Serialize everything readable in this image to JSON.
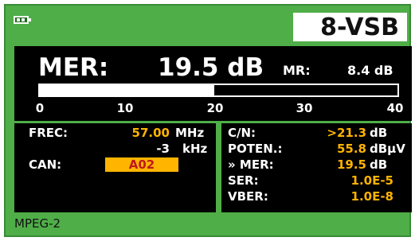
{
  "header": {
    "battery_icon": "battery-icon",
    "mode": "8-VSB"
  },
  "mer": {
    "label": "MER:",
    "value": "19.5 dB",
    "mr_label": "MR:",
    "mr_value": "8.4 dB",
    "bar_level": 19.5,
    "bar_max": 40,
    "scale": [
      "0",
      "10",
      "20",
      "30",
      "40"
    ]
  },
  "tuning": {
    "freq_label": "FREC:",
    "freq_value": "57.00",
    "freq_unit": "MHz",
    "offset_value": "-3",
    "offset_unit": "kHz",
    "channel_label": "CAN:",
    "channel_value": "A02"
  },
  "measurements": {
    "cn_label": "C/N:",
    "cn_value": ">21.3",
    "cn_unit": "dB",
    "power_label": "POTEN.:",
    "power_value": "55.8",
    "power_unit": "dBµV",
    "mer_label": "» MER:",
    "mer_value": "19.5",
    "mer_unit": "dB",
    "ser_label": "SER:",
    "ser_value": "1.0E-5",
    "vber_label": "VBER:",
    "vber_value": "1.0E-8"
  },
  "footer": {
    "standard": "MPEG-2"
  },
  "colors": {
    "frame": "#4fae48",
    "panel": "#000000",
    "value": "#ffb400",
    "channel_text": "#c0181a"
  }
}
